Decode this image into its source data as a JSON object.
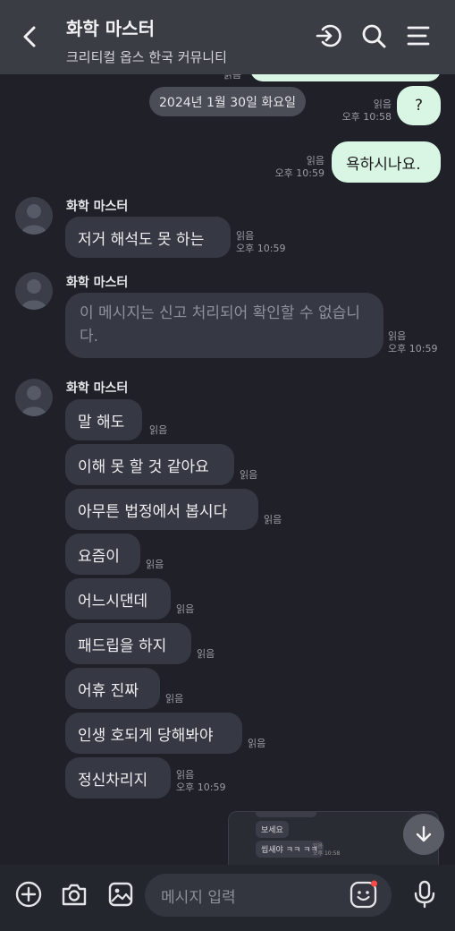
{
  "header": {
    "title": "화학 마스터",
    "subtitle": "크리티컬 옵스 한국 커뮤니티"
  },
  "top_partial": {
    "read": "읽음"
  },
  "date_divider": "2024년 1월 30일 화요일",
  "my_messages": [
    {
      "text": "?",
      "read": "읽음",
      "time": "오후 10:58"
    },
    {
      "text": "욕하시나요.",
      "read": "읽음",
      "time": "오후 10:59"
    }
  ],
  "groups": [
    {
      "name": "화학 마스터",
      "messages": [
        {
          "text": "저거 해석도 못 하는",
          "read": "읽음",
          "time": "오후 10:59"
        }
      ]
    },
    {
      "name": "화학 마스터",
      "report_text": "이 메시지는 신고 처리되어 확인할 수 없습니다.",
      "read": "읽음",
      "time": "오후 10:59"
    },
    {
      "name": "화학 마스터",
      "messages": [
        {
          "text": "말 해도",
          "read": "읽음",
          "time": ""
        },
        {
          "text": "이해 못 할 것 같아요",
          "read": "읽음",
          "time": ""
        },
        {
          "text": "아무튼 법정에서 봅시다",
          "read": "읽음",
          "time": ""
        },
        {
          "text": "요즘이",
          "read": "읽음",
          "time": ""
        },
        {
          "text": "어느시댄데",
          "read": "읽음",
          "time": ""
        },
        {
          "text": "패드립을 하지",
          "read": "읽음",
          "time": ""
        },
        {
          "text": "어휴 진짜",
          "read": "읽음",
          "time": ""
        },
        {
          "text": "인생 호되게 당해봐야",
          "read": "읽음",
          "time": ""
        },
        {
          "text": "정신차리지",
          "read": "읽음",
          "time": "오후 10:59"
        }
      ]
    }
  ],
  "preview": {
    "messages": [
      {
        "text": "보세요"
      },
      {
        "text": "씹새야 ㅋㅋ ㅋㅋ",
        "read": "읽음",
        "time": "오후 10:58"
      }
    ]
  },
  "input": {
    "placeholder": "메시지 입력"
  },
  "colors": {
    "my_bubble": "#d9f5e3",
    "other_bubble": "#363944",
    "background": "#1f2028",
    "header": "#3a3d44",
    "emoji_badge": "#ff4a4a"
  },
  "icons": [
    "back-icon",
    "enter-room-icon",
    "search-icon",
    "menu-icon",
    "plus-icon",
    "camera-icon",
    "gallery-icon",
    "emoji-icon",
    "mic-icon",
    "arrow-down-icon"
  ]
}
